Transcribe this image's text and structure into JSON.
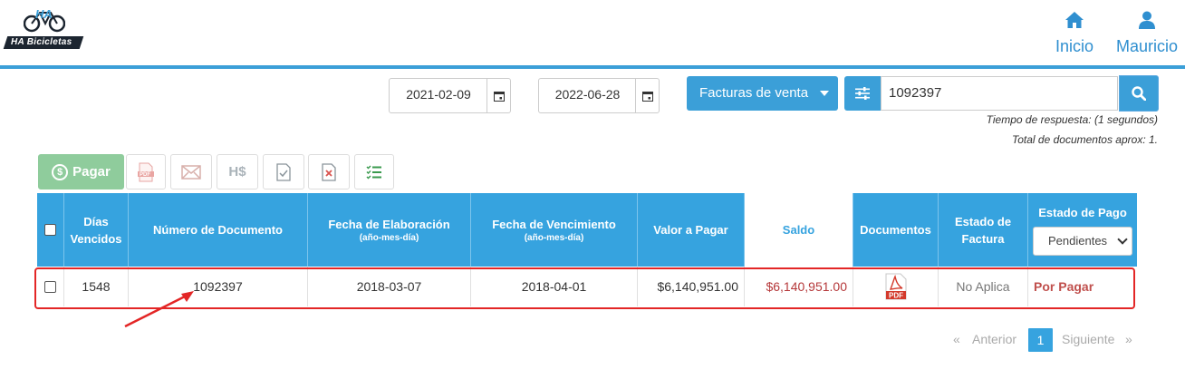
{
  "brand": {
    "logo_text": "HA Bicicletas",
    "logo_mark": "HA"
  },
  "nav": {
    "home_label": "Inicio",
    "home_icon": "home-icon",
    "user_label": "Mauricio",
    "user_icon": "user-icon"
  },
  "filters": {
    "date_from": "2021-02-09",
    "date_to": "2022-06-28",
    "doc_type": "Facturas de venta",
    "search_value": "1092397",
    "response_time": "Tiempo de respuesta: (1 segundos)",
    "total_docs": "Total de documentos aprox: 1."
  },
  "toolbar": {
    "pay_label": "Pagar",
    "pay_coin": "$",
    "hs_label": "H$"
  },
  "table": {
    "headers": {
      "days_overdue": [
        "Días",
        "Vencidos"
      ],
      "doc_number": "Número de Documento",
      "creation_date": "Fecha de Elaboración",
      "creation_date_sub": "(año-mes-día)",
      "due_date": "Fecha de Vencimiento",
      "due_date_sub": "(año-mes-día)",
      "amount": "Valor a Pagar",
      "balance": "Saldo",
      "documents": "Documentos",
      "invoice_status": [
        "Estado de",
        "Factura"
      ],
      "payment_status": "Estado de Pago",
      "payment_filter": "Pendientes"
    },
    "rows": [
      {
        "days": "1548",
        "number": "1092397",
        "created": "2018-03-07",
        "due": "2018-04-01",
        "amount": "$6,140,951.00",
        "balance": "$6,140,951.00",
        "doc_icon": "pdf-icon",
        "invoice_status": "No Aplica",
        "payment_status": "Por Pagar"
      }
    ]
  },
  "pagination": {
    "first": "«",
    "prev": "Anterior",
    "current": "1",
    "next": "Siguiente",
    "last": "»"
  },
  "colors": {
    "primary": "#36a3df",
    "pay_green": "#8fcc9c",
    "balance_red": "#b5383a",
    "highlight": "#e32626"
  }
}
